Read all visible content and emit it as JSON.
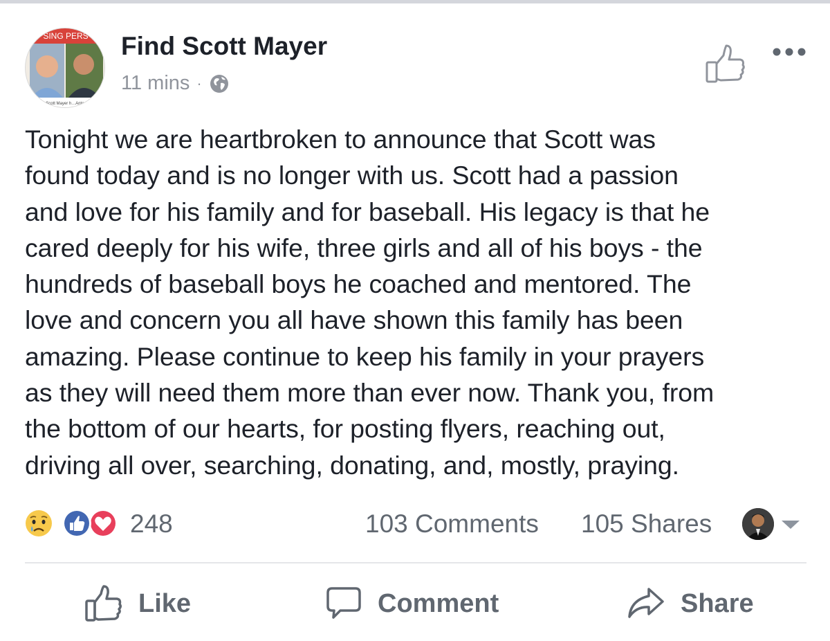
{
  "post": {
    "author": "Find Scott Mayer",
    "time": "11 mins",
    "separator": "·",
    "visibility_icon": "globe-icon",
    "avatar_banner_text": "SING PERS",
    "avatar_caption_text": "bring Scott Mayer h…Antonio TX",
    "body": "Tonight we are heartbroken to announce that Scott was\nfound today and is no longer with us. Scott had a passion\nand love for his family and for baseball. His legacy is that he\ncared deeply for his wife, three girls and all of his boys - the\nhundreds of baseball boys he coached and mentored. The\nlove and concern you all have shown this family has been\namazing. Please continue to keep his family in your prayers\nas they will need them more than ever now. Thank you, from\nthe bottom of our hearts, for posting flyers, reaching out,\ndriving all over, searching, donating, and, mostly, praying."
  },
  "header_icons": [
    "thumbs-up-outline-icon",
    "more-options-icon"
  ],
  "engagement": {
    "reactions": [
      "sad-reaction-icon",
      "like-reaction-icon",
      "love-reaction-icon"
    ],
    "reaction_count": "248",
    "comments": "103 Comments",
    "shares": "105 Shares"
  },
  "actions": {
    "like": "Like",
    "comment": "Comment",
    "share": "Share"
  },
  "colors": {
    "text": "#1d2129",
    "secondary": "#90949c",
    "action_gray": "#606770",
    "like_blue": "#4267b2",
    "love_red": "#e83f5b",
    "sad_yellow": "#f7c94b"
  }
}
